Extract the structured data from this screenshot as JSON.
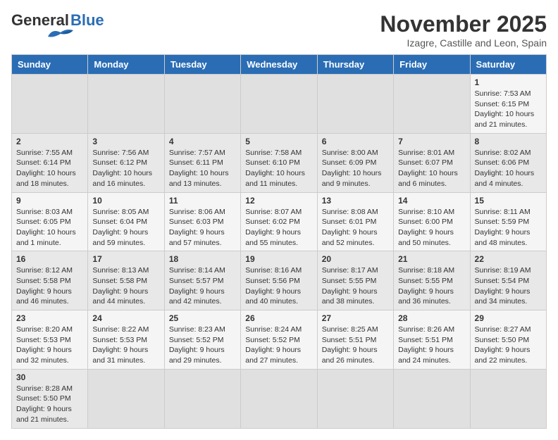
{
  "header": {
    "logo_general": "General",
    "logo_blue": "Blue",
    "month_title": "November 2025",
    "subtitle": "Izagre, Castille and Leon, Spain"
  },
  "days_of_week": [
    "Sunday",
    "Monday",
    "Tuesday",
    "Wednesday",
    "Thursday",
    "Friday",
    "Saturday"
  ],
  "weeks": [
    [
      {
        "day": "",
        "info": ""
      },
      {
        "day": "",
        "info": ""
      },
      {
        "day": "",
        "info": ""
      },
      {
        "day": "",
        "info": ""
      },
      {
        "day": "",
        "info": ""
      },
      {
        "day": "",
        "info": ""
      },
      {
        "day": "1",
        "info": "Sunrise: 7:53 AM\nSunset: 6:15 PM\nDaylight: 10 hours\nand 21 minutes."
      }
    ],
    [
      {
        "day": "2",
        "info": "Sunrise: 7:55 AM\nSunset: 6:14 PM\nDaylight: 10 hours\nand 18 minutes."
      },
      {
        "day": "3",
        "info": "Sunrise: 7:56 AM\nSunset: 6:12 PM\nDaylight: 10 hours\nand 16 minutes."
      },
      {
        "day": "4",
        "info": "Sunrise: 7:57 AM\nSunset: 6:11 PM\nDaylight: 10 hours\nand 13 minutes."
      },
      {
        "day": "5",
        "info": "Sunrise: 7:58 AM\nSunset: 6:10 PM\nDaylight: 10 hours\nand 11 minutes."
      },
      {
        "day": "6",
        "info": "Sunrise: 8:00 AM\nSunset: 6:09 PM\nDaylight: 10 hours\nand 9 minutes."
      },
      {
        "day": "7",
        "info": "Sunrise: 8:01 AM\nSunset: 6:07 PM\nDaylight: 10 hours\nand 6 minutes."
      },
      {
        "day": "8",
        "info": "Sunrise: 8:02 AM\nSunset: 6:06 PM\nDaylight: 10 hours\nand 4 minutes."
      }
    ],
    [
      {
        "day": "9",
        "info": "Sunrise: 8:03 AM\nSunset: 6:05 PM\nDaylight: 10 hours\nand 1 minute."
      },
      {
        "day": "10",
        "info": "Sunrise: 8:05 AM\nSunset: 6:04 PM\nDaylight: 9 hours\nand 59 minutes."
      },
      {
        "day": "11",
        "info": "Sunrise: 8:06 AM\nSunset: 6:03 PM\nDaylight: 9 hours\nand 57 minutes."
      },
      {
        "day": "12",
        "info": "Sunrise: 8:07 AM\nSunset: 6:02 PM\nDaylight: 9 hours\nand 55 minutes."
      },
      {
        "day": "13",
        "info": "Sunrise: 8:08 AM\nSunset: 6:01 PM\nDaylight: 9 hours\nand 52 minutes."
      },
      {
        "day": "14",
        "info": "Sunrise: 8:10 AM\nSunset: 6:00 PM\nDaylight: 9 hours\nand 50 minutes."
      },
      {
        "day": "15",
        "info": "Sunrise: 8:11 AM\nSunset: 5:59 PM\nDaylight: 9 hours\nand 48 minutes."
      }
    ],
    [
      {
        "day": "16",
        "info": "Sunrise: 8:12 AM\nSunset: 5:58 PM\nDaylight: 9 hours\nand 46 minutes."
      },
      {
        "day": "17",
        "info": "Sunrise: 8:13 AM\nSunset: 5:58 PM\nDaylight: 9 hours\nand 44 minutes."
      },
      {
        "day": "18",
        "info": "Sunrise: 8:14 AM\nSunset: 5:57 PM\nDaylight: 9 hours\nand 42 minutes."
      },
      {
        "day": "19",
        "info": "Sunrise: 8:16 AM\nSunset: 5:56 PM\nDaylight: 9 hours\nand 40 minutes."
      },
      {
        "day": "20",
        "info": "Sunrise: 8:17 AM\nSunset: 5:55 PM\nDaylight: 9 hours\nand 38 minutes."
      },
      {
        "day": "21",
        "info": "Sunrise: 8:18 AM\nSunset: 5:55 PM\nDaylight: 9 hours\nand 36 minutes."
      },
      {
        "day": "22",
        "info": "Sunrise: 8:19 AM\nSunset: 5:54 PM\nDaylight: 9 hours\nand 34 minutes."
      }
    ],
    [
      {
        "day": "23",
        "info": "Sunrise: 8:20 AM\nSunset: 5:53 PM\nDaylight: 9 hours\nand 32 minutes."
      },
      {
        "day": "24",
        "info": "Sunrise: 8:22 AM\nSunset: 5:53 PM\nDaylight: 9 hours\nand 31 minutes."
      },
      {
        "day": "25",
        "info": "Sunrise: 8:23 AM\nSunset: 5:52 PM\nDaylight: 9 hours\nand 29 minutes."
      },
      {
        "day": "26",
        "info": "Sunrise: 8:24 AM\nSunset: 5:52 PM\nDaylight: 9 hours\nand 27 minutes."
      },
      {
        "day": "27",
        "info": "Sunrise: 8:25 AM\nSunset: 5:51 PM\nDaylight: 9 hours\nand 26 minutes."
      },
      {
        "day": "28",
        "info": "Sunrise: 8:26 AM\nSunset: 5:51 PM\nDaylight: 9 hours\nand 24 minutes."
      },
      {
        "day": "29",
        "info": "Sunrise: 8:27 AM\nSunset: 5:50 PM\nDaylight: 9 hours\nand 22 minutes."
      }
    ],
    [
      {
        "day": "30",
        "info": "Sunrise: 8:28 AM\nSunset: 5:50 PM\nDaylight: 9 hours\nand 21 minutes."
      },
      {
        "day": "",
        "info": ""
      },
      {
        "day": "",
        "info": ""
      },
      {
        "day": "",
        "info": ""
      },
      {
        "day": "",
        "info": ""
      },
      {
        "day": "",
        "info": ""
      },
      {
        "day": "",
        "info": ""
      }
    ]
  ]
}
